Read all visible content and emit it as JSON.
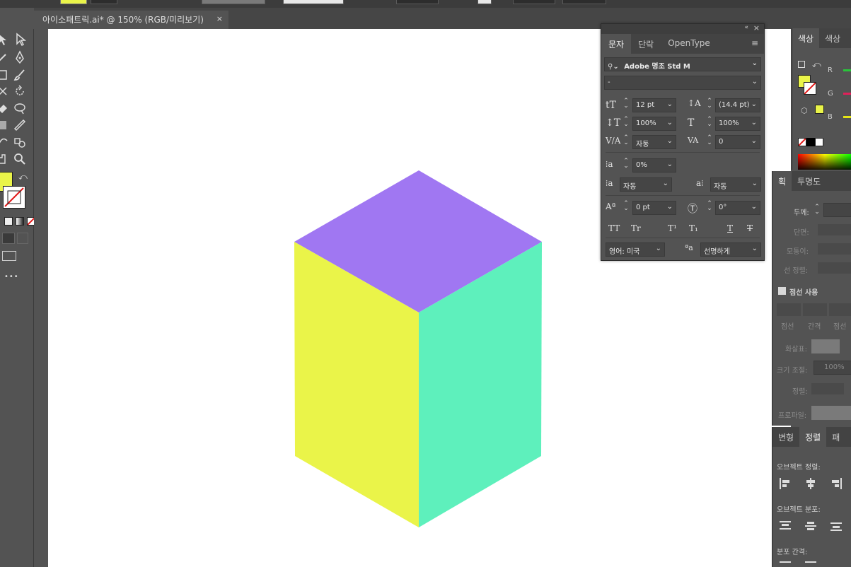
{
  "document": {
    "tab_title": "아이소패트릭.ai* @ 150% (RGB/미리보기)",
    "close_glyph": "×"
  },
  "colors": {
    "cube_top": "#a077f2",
    "cube_left": "#eaf449",
    "cube_right": "#5ef0bc",
    "fill_swatch": "#eaf449"
  },
  "character_panel": {
    "tabs": [
      "문자",
      "단락",
      "OpenType"
    ],
    "font_family": "Adobe 명조 Std M",
    "font_style": "-",
    "font_size": "12 pt",
    "leading": "(14.4 pt)",
    "vertical_scale": "100%",
    "horizontal_scale": "100%",
    "kerning": "자동",
    "tracking": "0",
    "tsume": "0%",
    "aki_left": "자동",
    "aki_right": "자동",
    "baseline_shift": "0 pt",
    "rotation": "0°",
    "type_buttons": [
      "TT",
      "Tr",
      "T¹",
      "T₁",
      "T",
      "T"
    ],
    "language": "영어: 미국",
    "antialias_icon": "ªa",
    "antialias": "선명하게"
  },
  "color_panel": {
    "tabs": [
      "색상",
      "색상"
    ],
    "channels": [
      "R",
      "G",
      "B"
    ]
  },
  "stroke_panel": {
    "tabs": [
      "획",
      "투명도"
    ],
    "weight_label": "두께:",
    "cap_label": "단면:",
    "corner_label": "모퉁이:",
    "align_label": "선 정렬:",
    "dashed_label": "점선 사용",
    "dash_labels": [
      "점선",
      "간격",
      "점선"
    ],
    "arrow_label": "화살표:",
    "scale_label": "크기 조절:",
    "scale_value": "100%",
    "align2_label": "정렬:",
    "profile_label": "프로파일:"
  },
  "align_panel": {
    "tabs": [
      "변형",
      "정렬",
      "패"
    ],
    "align_objects_label": "오브젝트 정렬:",
    "distribute_objects_label": "오브젝트 분포:",
    "distribute_spacing_label": "분포 간격:"
  },
  "toolbar": {
    "more_glyph": "•••"
  }
}
